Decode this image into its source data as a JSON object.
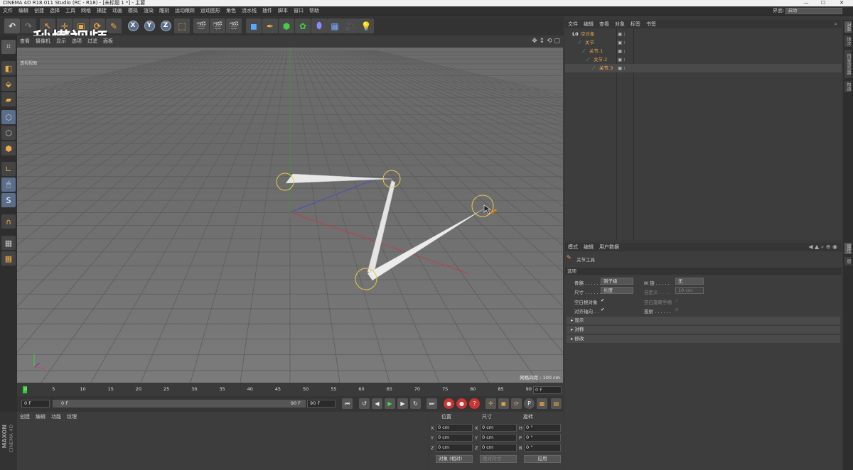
{
  "window": {
    "title": "CINEMA 4D R18.011 Studio (RC - R18) - [未标题 1 *] - 主要",
    "controls": [
      "—",
      "☐",
      "✕"
    ]
  },
  "menu": {
    "items": [
      "文件",
      "编辑",
      "创建",
      "选择",
      "工具",
      "网格",
      "捕捉",
      "动画",
      "模拟",
      "渲染",
      "雕刻",
      "运动跟踪",
      "运动图形",
      "角色",
      "流水线",
      "插件",
      "脚本",
      "窗口",
      "帮助"
    ],
    "layout_label": "界面:",
    "layout_value": "启动"
  },
  "watermark": "秒懂视频",
  "viewport": {
    "menu": [
      "查看",
      "摄像机",
      "显示",
      "选项",
      "过滤",
      "面板"
    ],
    "label": "透视视图",
    "grid_spacing": "网格间距 : 100 cm",
    "nav_icons": "✥ ↕ ⟲ ▢"
  },
  "timeline": {
    "ticks": [
      "0",
      "5",
      "10",
      "15",
      "20",
      "25",
      "30",
      "35",
      "40",
      "45",
      "50",
      "55",
      "60",
      "65",
      "70",
      "75",
      "80",
      "85",
      "90"
    ],
    "current_frame": "0 F",
    "start_field": "0 F",
    "range_left": "0 F",
    "range_right": "90 F",
    "end_field": "90 F"
  },
  "material_manager": {
    "menu": [
      "创建",
      "编辑",
      "功能",
      "纹理"
    ]
  },
  "brand": {
    "line1": "MAXON",
    "line2": "CINEMA 4D"
  },
  "coordinates": {
    "headers": [
      "位置",
      "尺寸",
      "旋转"
    ],
    "rows": [
      {
        "axis": "X",
        "pos": "0 cm",
        "size_axis": "X",
        "size": "0 cm",
        "rot_axis": "H",
        "rot": "0 °"
      },
      {
        "axis": "Y",
        "pos": "0 cm",
        "size_axis": "Y",
        "size": "0 cm",
        "rot_axis": "P",
        "rot": "0 °"
      },
      {
        "axis": "Z",
        "pos": "0 cm",
        "size_axis": "Z",
        "size": "0 cm",
        "rot_axis": "B",
        "rot": "0 °"
      }
    ],
    "mode_select": "对象 (相对)",
    "size_select": "绝对尺寸",
    "apply_button": "应用"
  },
  "object_manager": {
    "menu": [
      "文件",
      "编辑",
      "查看",
      "对象",
      "标签",
      "书签"
    ],
    "objects": [
      {
        "name": "空对象",
        "indent": 0,
        "icon": "null-icon"
      },
      {
        "name": "关节",
        "indent": 1,
        "icon": "joint-icon"
      },
      {
        "name": "关节.1",
        "indent": 2,
        "icon": "joint-icon"
      },
      {
        "name": "关节.2",
        "indent": 3,
        "icon": "joint-icon"
      },
      {
        "name": "关节.3",
        "indent": 4,
        "icon": "joint-icon",
        "selected": true
      }
    ]
  },
  "attribute_manager": {
    "menu": [
      "模式",
      "编辑",
      "用户数据"
    ],
    "tool_title": "关节工具",
    "section": "选项",
    "fields": {
      "bone_label": "骨骼 . . . . . .",
      "bone_value": "到子级",
      "ik_label": "IK 链 . . . . .",
      "ik_value": "无",
      "size_label": "尺寸 . . . . . .",
      "size_value": "长度",
      "custom_label": "自定义 . . . .",
      "custom_value": "10 cm",
      "null_parent_label": "空白根对象",
      "null_parent_check": "✔",
      "null_rot_label": "空白旋转手柄",
      "align_label": "对齐轴向 . .",
      "align_check": "✔",
      "projection_label": "投射 . . . . . ."
    },
    "groups": [
      "显示",
      "对称",
      "修改"
    ]
  },
  "right_tabs": [
    "对象",
    "场次",
    "内容浏览器",
    "构造",
    "属性",
    "层"
  ]
}
